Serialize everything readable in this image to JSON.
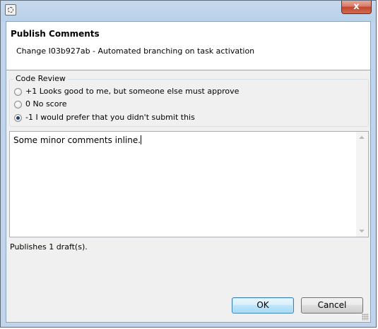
{
  "window": {
    "icon": "eclipse-app-icon",
    "close_label": "x"
  },
  "dialog": {
    "title": "Publish Comments",
    "subtitle": "Change I03b927ab - Automated branching on task activation"
  },
  "code_review": {
    "legend": "Code Review",
    "options": [
      {
        "label": "+1 Looks good to me, but someone else must approve",
        "selected": false
      },
      {
        "label": "0 No score",
        "selected": false
      },
      {
        "label": "-1 I would prefer that you didn't submit this",
        "selected": true
      }
    ]
  },
  "comment": {
    "value": "Some minor comments inline."
  },
  "status": {
    "publishes": "Publishes 1 draft(s)."
  },
  "buttons": {
    "ok": "OK",
    "cancel": "Cancel"
  },
  "colors": {
    "accent": "#3c7fb1",
    "close": "#c2462f"
  }
}
